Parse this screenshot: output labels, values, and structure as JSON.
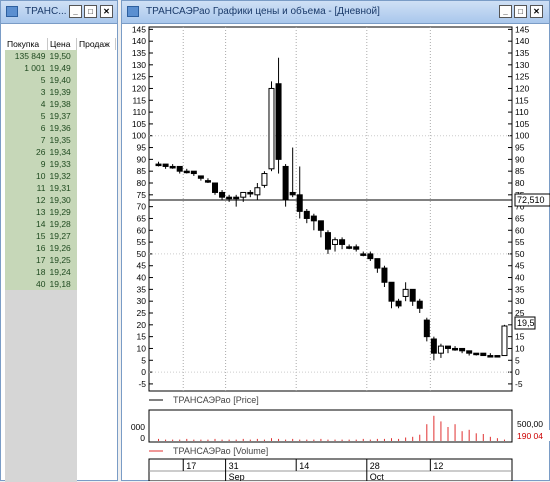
{
  "orderbook": {
    "title": "ТРАНС...",
    "columns": [
      "Покупка",
      "Цена",
      "Продаж"
    ],
    "rows": [
      {
        "buy": "135 849",
        "price": "19,50"
      },
      {
        "buy": "1 001",
        "price": "19,49"
      },
      {
        "buy": "5",
        "price": "19,40"
      },
      {
        "buy": "3",
        "price": "19,39"
      },
      {
        "buy": "4",
        "price": "19,38"
      },
      {
        "buy": "5",
        "price": "19,37"
      },
      {
        "buy": "6",
        "price": "19,36"
      },
      {
        "buy": "7",
        "price": "19,35"
      },
      {
        "buy": "26",
        "price": "19,34"
      },
      {
        "buy": "9",
        "price": "19,33"
      },
      {
        "buy": "10",
        "price": "19,32"
      },
      {
        "buy": "11",
        "price": "19,31"
      },
      {
        "buy": "12",
        "price": "19,30"
      },
      {
        "buy": "13",
        "price": "19,29"
      },
      {
        "buy": "14",
        "price": "19,28"
      },
      {
        "buy": "15",
        "price": "19,27"
      },
      {
        "buy": "16",
        "price": "19,26"
      },
      {
        "buy": "17",
        "price": "19,25"
      },
      {
        "buy": "18",
        "price": "19,24"
      },
      {
        "buy": "40",
        "price": "19,18"
      }
    ]
  },
  "chart_window": {
    "title": "ТРАНСАЭРао Графики цены и объема - [Дневной]",
    "crosshair_value": "72,510",
    "last_price_label": "19,5",
    "price_legend": "ТРАНСАЭРао [Price]",
    "volume_legend": "ТРАНСАЭРао [Volume]",
    "volume_axis_left": [
      "000",
      "0"
    ],
    "volume_axis_right": [
      "500,00",
      "190 04"
    ],
    "date_labels": [
      "17",
      "31",
      "14",
      "28",
      "12"
    ],
    "month_labels": [
      "Sep",
      "Oct"
    ],
    "colors": {
      "price_line": "#000000",
      "volume_bar": "#e03030",
      "crosshair": "#000000"
    }
  },
  "chart_data": {
    "type": "candlestick",
    "yticks": [
      145,
      140,
      135,
      130,
      125,
      120,
      115,
      110,
      105,
      100,
      95,
      90,
      85,
      80,
      75,
      70,
      65,
      60,
      55,
      50,
      45,
      40,
      35,
      30,
      25,
      20,
      15,
      10,
      5,
      0,
      -5
    ],
    "ylim": [
      -8,
      146
    ],
    "candles": [
      {
        "o": 88,
        "c": 88,
        "h": 89,
        "l": 87
      },
      {
        "o": 88,
        "c": 87,
        "h": 88,
        "l": 86
      },
      {
        "o": 87,
        "c": 87,
        "h": 88,
        "l": 86
      },
      {
        "o": 87,
        "c": 85,
        "h": 87,
        "l": 84
      },
      {
        "o": 85,
        "c": 85,
        "h": 86,
        "l": 84
      },
      {
        "o": 85,
        "c": 84,
        "h": 85,
        "l": 83
      },
      {
        "o": 83,
        "c": 82,
        "h": 83,
        "l": 81
      },
      {
        "o": 81,
        "c": 81,
        "h": 82,
        "l": 80
      },
      {
        "o": 80,
        "c": 76,
        "h": 80,
        "l": 75
      },
      {
        "o": 76,
        "c": 74,
        "h": 77,
        "l": 73
      },
      {
        "o": 74,
        "c": 74,
        "h": 75,
        "l": 72
      },
      {
        "o": 74,
        "c": 74,
        "h": 75,
        "l": 70
      },
      {
        "o": 74,
        "c": 76,
        "h": 76,
        "l": 72
      },
      {
        "o": 76,
        "c": 76,
        "h": 77,
        "l": 74
      },
      {
        "o": 75,
        "c": 78,
        "h": 80,
        "l": 73
      },
      {
        "o": 79,
        "c": 84,
        "h": 85,
        "l": 78
      },
      {
        "o": 86,
        "c": 120,
        "h": 123,
        "l": 85
      },
      {
        "o": 122,
        "c": 90,
        "h": 133,
        "l": 84
      },
      {
        "o": 87,
        "c": 73,
        "h": 88,
        "l": 70
      },
      {
        "o": 76,
        "c": 75,
        "h": 95,
        "l": 74
      },
      {
        "o": 75,
        "c": 68,
        "h": 87,
        "l": 65
      },
      {
        "o": 68,
        "c": 65,
        "h": 69,
        "l": 63
      },
      {
        "o": 66,
        "c": 64,
        "h": 67,
        "l": 60
      },
      {
        "o": 64,
        "c": 60,
        "h": 64,
        "l": 57
      },
      {
        "o": 59,
        "c": 52,
        "h": 60,
        "l": 50
      },
      {
        "o": 54,
        "c": 56,
        "h": 57,
        "l": 51
      },
      {
        "o": 56,
        "c": 54,
        "h": 57,
        "l": 52
      },
      {
        "o": 53,
        "c": 53,
        "h": 54,
        "l": 52
      },
      {
        "o": 53,
        "c": 52,
        "h": 54,
        "l": 51
      },
      {
        "o": 50,
        "c": 50,
        "h": 51,
        "l": 49
      },
      {
        "o": 50,
        "c": 48,
        "h": 51,
        "l": 47
      },
      {
        "o": 48,
        "c": 44,
        "h": 48,
        "l": 42
      },
      {
        "o": 44,
        "c": 38,
        "h": 45,
        "l": 36
      },
      {
        "o": 38,
        "c": 30,
        "h": 38,
        "l": 27
      },
      {
        "o": 30,
        "c": 28,
        "h": 31,
        "l": 27
      },
      {
        "o": 32,
        "c": 35,
        "h": 38,
        "l": 30
      },
      {
        "o": 35,
        "c": 30,
        "h": 35,
        "l": 28
      },
      {
        "o": 30,
        "c": 27,
        "h": 31,
        "l": 25
      },
      {
        "o": 22,
        "c": 15,
        "h": 23,
        "l": 13
      },
      {
        "o": 14,
        "c": 8,
        "h": 15,
        "l": 5
      },
      {
        "o": 8,
        "c": 11,
        "h": 12,
        "l": 6
      },
      {
        "o": 11,
        "c": 10,
        "h": 11,
        "l": 8
      },
      {
        "o": 10,
        "c": 10,
        "h": 11,
        "l": 9
      },
      {
        "o": 10,
        "c": 9,
        "h": 10,
        "l": 8
      },
      {
        "o": 9,
        "c": 8,
        "h": 9,
        "l": 7
      },
      {
        "o": 8,
        "c": 8,
        "h": 8,
        "l": 7
      },
      {
        "o": 8,
        "c": 7,
        "h": 8,
        "l": 7
      },
      {
        "o": 7,
        "c": 7,
        "h": 8,
        "l": 7
      },
      {
        "o": 7,
        "c": 7,
        "h": 7,
        "l": 7
      },
      {
        "o": 7,
        "c": 19.5,
        "h": 20,
        "l": 7
      }
    ],
    "volume": [
      0.3,
      0.2,
      0.2,
      0.2,
      0.3,
      0.2,
      0.2,
      0.2,
      0.3,
      0.2,
      0.2,
      0.2,
      0.3,
      0.2,
      0.3,
      0.2,
      0.4,
      0.3,
      0.2,
      0.3,
      0.2,
      0.2,
      0.2,
      0.3,
      0.2,
      0.2,
      0.2,
      0.2,
      0.2,
      0.3,
      0.2,
      0.3,
      0.3,
      0.4,
      0.3,
      0.5,
      0.6,
      0.9,
      2.4,
      3.6,
      2.8,
      2.0,
      2.4,
      1.4,
      1.6,
      1.1,
      1.0,
      0.6,
      0.4,
      0.2
    ]
  }
}
